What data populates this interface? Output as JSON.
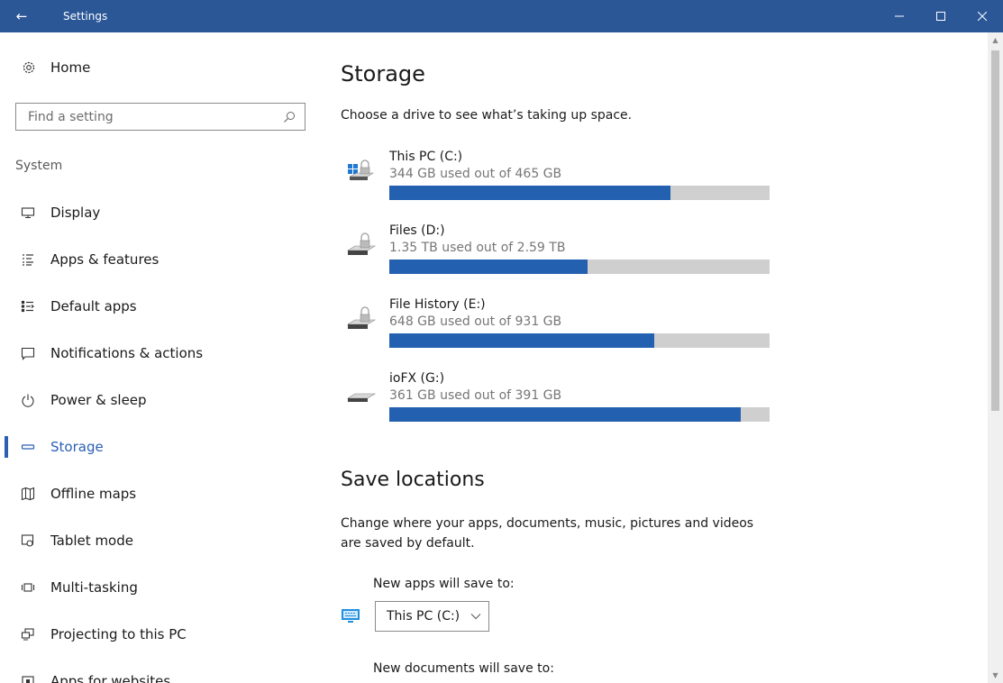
{
  "window": {
    "title": "Settings",
    "back_icon": "←",
    "minimize": "—",
    "maximize": "☐",
    "close": "✕",
    "titlebar_color": "#2b5797"
  },
  "sidebar": {
    "home_label": "Home",
    "search_placeholder": "Find a setting",
    "section": "System",
    "items": [
      {
        "label": "Display",
        "icon": "display-icon"
      },
      {
        "label": "Apps & features",
        "icon": "apps-features-icon"
      },
      {
        "label": "Default apps",
        "icon": "default-apps-icon"
      },
      {
        "label": "Notifications & actions",
        "icon": "notifications-icon"
      },
      {
        "label": "Power & sleep",
        "icon": "power-icon"
      },
      {
        "label": "Storage",
        "icon": "storage-icon",
        "active": true
      },
      {
        "label": "Offline maps",
        "icon": "map-icon"
      },
      {
        "label": "Tablet mode",
        "icon": "tablet-mode-icon"
      },
      {
        "label": "Multi-tasking",
        "icon": "multitasking-icon"
      },
      {
        "label": "Projecting to this PC",
        "icon": "projecting-icon"
      },
      {
        "label": "Apps for websites",
        "icon": "apps-websites-icon"
      }
    ],
    "accent_color": "#2b5fb4"
  },
  "main": {
    "title": "Storage",
    "subtitle": "Choose a drive to see what’s taking up space.",
    "drives": [
      {
        "name": "This PC (C:)",
        "usage": "344 GB used out of 465 GB",
        "fraction": 0.7398,
        "icon": "system-drive-icon"
      },
      {
        "name": "Files (D:)",
        "usage": "1.35 TB used out of 2.59 TB",
        "fraction": 0.5212,
        "icon": "drive-icon"
      },
      {
        "name": "File History (E:)",
        "usage": "648 GB used out of 931 GB",
        "fraction": 0.696,
        "icon": "drive-icon"
      },
      {
        "name": "ioFX (G:)",
        "usage": "361 GB used out of 391 GB",
        "fraction": 0.9233,
        "icon": "removable-drive-icon"
      }
    ],
    "bar_fill_color": "#2460b0",
    "bar_track_color": "#cfcfcf",
    "save_locations": {
      "title": "Save locations",
      "description": "Change where your apps, documents, music, pictures and videos are saved by default.",
      "new_apps_label": "New apps will save to:",
      "new_apps_value": "This PC (C:)",
      "new_docs_label": "New documents will save to:"
    }
  }
}
